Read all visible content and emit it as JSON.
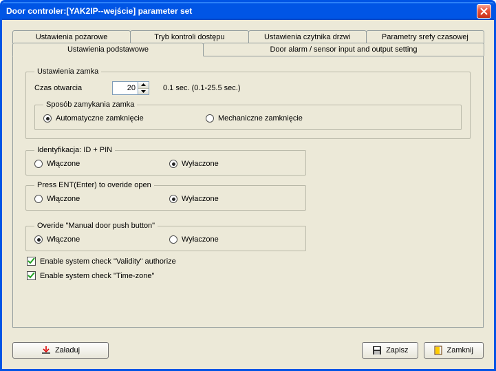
{
  "window": {
    "title": "Door controler:[YAK2IP--wejście] parameter set"
  },
  "tabs": {
    "row1": [
      "Ustawienia pożarowe",
      "Tryb kontroli dostępu",
      "Ustawienia czytnika drzwi",
      "Parametry srefy czasowej"
    ],
    "row2": [
      "Ustawienia podstawowe",
      "Door alarm / sensor input and output setting"
    ],
    "active": "Ustawienia podstawowe"
  },
  "lock": {
    "legend": "Ustawienia zamka",
    "open_time_label": "Czas otwarcia",
    "open_time_value": "20",
    "open_time_unit": "0.1 sec. (0.1-25.5 sec.)",
    "close_method": {
      "legend": "Sposób zamykania zamka",
      "auto": "Automatyczne zamknięcie",
      "mech": "Mechaniczne zamknięcie",
      "selected": "auto"
    }
  },
  "idpin": {
    "legend": "Identyfikacja: ID + PIN",
    "on": "Włączone",
    "off": "Wyłaczone",
    "selected": "off"
  },
  "ent_override": {
    "legend": "Press ENT(Enter) to overide open",
    "on": "Włączone",
    "off": "Wyłaczone",
    "selected": "off"
  },
  "manual_override": {
    "legend": "Overide \"Manual door push button\"",
    "on": "Włączone",
    "off": "Wyłaczone",
    "selected": "on"
  },
  "validity_check": {
    "label": "Enable system check \"Validity\" authorize",
    "checked": true
  },
  "timezone_check": {
    "label": "Enable system check \"Time-zone\"",
    "checked": true
  },
  "buttons": {
    "load": "Załaduj",
    "save": "Zapisz",
    "close": "Zamknij"
  }
}
